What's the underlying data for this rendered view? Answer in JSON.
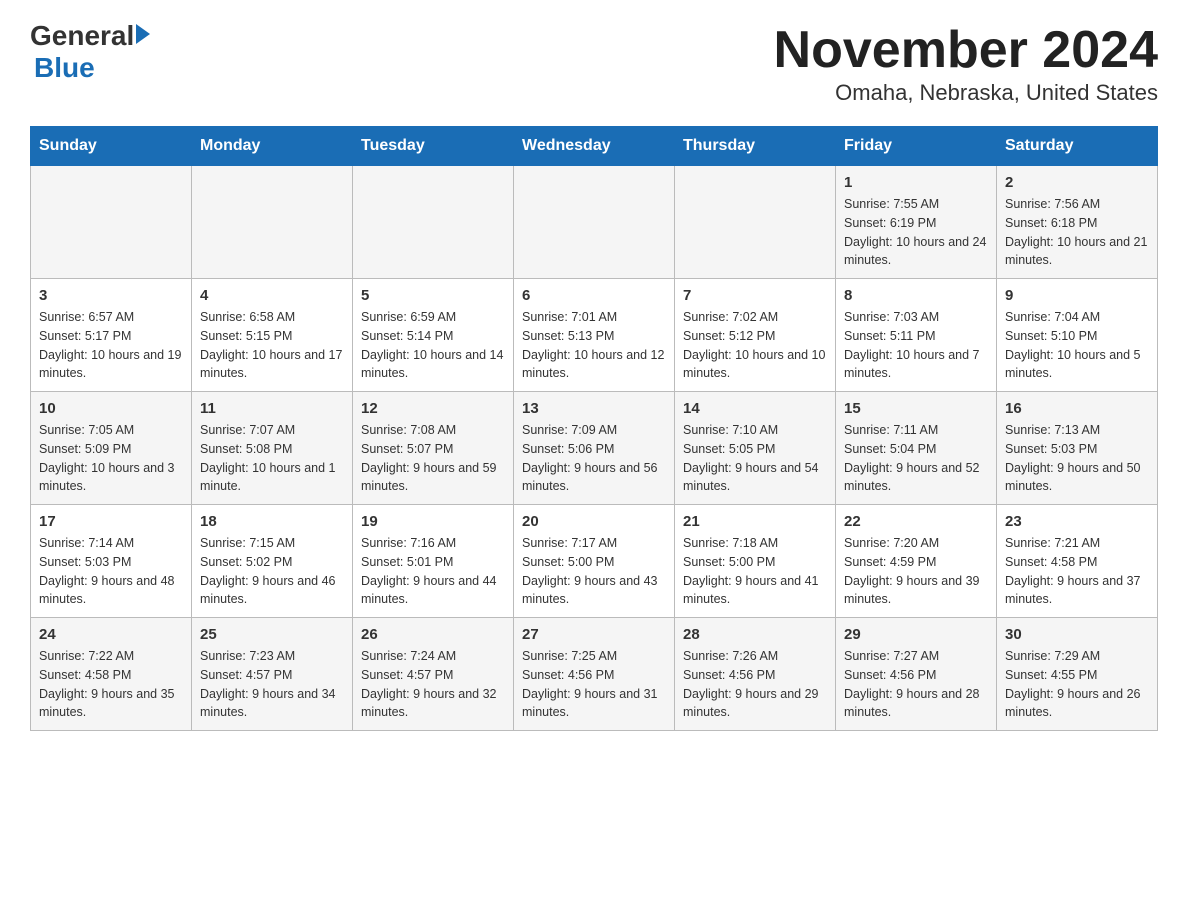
{
  "logo": {
    "general": "General",
    "blue": "Blue"
  },
  "title": "November 2024",
  "subtitle": "Omaha, Nebraska, United States",
  "weekdays": [
    "Sunday",
    "Monday",
    "Tuesday",
    "Wednesday",
    "Thursday",
    "Friday",
    "Saturday"
  ],
  "weeks": [
    [
      {
        "day": "",
        "info": ""
      },
      {
        "day": "",
        "info": ""
      },
      {
        "day": "",
        "info": ""
      },
      {
        "day": "",
        "info": ""
      },
      {
        "day": "",
        "info": ""
      },
      {
        "day": "1",
        "info": "Sunrise: 7:55 AM\nSunset: 6:19 PM\nDaylight: 10 hours and 24 minutes."
      },
      {
        "day": "2",
        "info": "Sunrise: 7:56 AM\nSunset: 6:18 PM\nDaylight: 10 hours and 21 minutes."
      }
    ],
    [
      {
        "day": "3",
        "info": "Sunrise: 6:57 AM\nSunset: 5:17 PM\nDaylight: 10 hours and 19 minutes."
      },
      {
        "day": "4",
        "info": "Sunrise: 6:58 AM\nSunset: 5:15 PM\nDaylight: 10 hours and 17 minutes."
      },
      {
        "day": "5",
        "info": "Sunrise: 6:59 AM\nSunset: 5:14 PM\nDaylight: 10 hours and 14 minutes."
      },
      {
        "day": "6",
        "info": "Sunrise: 7:01 AM\nSunset: 5:13 PM\nDaylight: 10 hours and 12 minutes."
      },
      {
        "day": "7",
        "info": "Sunrise: 7:02 AM\nSunset: 5:12 PM\nDaylight: 10 hours and 10 minutes."
      },
      {
        "day": "8",
        "info": "Sunrise: 7:03 AM\nSunset: 5:11 PM\nDaylight: 10 hours and 7 minutes."
      },
      {
        "day": "9",
        "info": "Sunrise: 7:04 AM\nSunset: 5:10 PM\nDaylight: 10 hours and 5 minutes."
      }
    ],
    [
      {
        "day": "10",
        "info": "Sunrise: 7:05 AM\nSunset: 5:09 PM\nDaylight: 10 hours and 3 minutes."
      },
      {
        "day": "11",
        "info": "Sunrise: 7:07 AM\nSunset: 5:08 PM\nDaylight: 10 hours and 1 minute."
      },
      {
        "day": "12",
        "info": "Sunrise: 7:08 AM\nSunset: 5:07 PM\nDaylight: 9 hours and 59 minutes."
      },
      {
        "day": "13",
        "info": "Sunrise: 7:09 AM\nSunset: 5:06 PM\nDaylight: 9 hours and 56 minutes."
      },
      {
        "day": "14",
        "info": "Sunrise: 7:10 AM\nSunset: 5:05 PM\nDaylight: 9 hours and 54 minutes."
      },
      {
        "day": "15",
        "info": "Sunrise: 7:11 AM\nSunset: 5:04 PM\nDaylight: 9 hours and 52 minutes."
      },
      {
        "day": "16",
        "info": "Sunrise: 7:13 AM\nSunset: 5:03 PM\nDaylight: 9 hours and 50 minutes."
      }
    ],
    [
      {
        "day": "17",
        "info": "Sunrise: 7:14 AM\nSunset: 5:03 PM\nDaylight: 9 hours and 48 minutes."
      },
      {
        "day": "18",
        "info": "Sunrise: 7:15 AM\nSunset: 5:02 PM\nDaylight: 9 hours and 46 minutes."
      },
      {
        "day": "19",
        "info": "Sunrise: 7:16 AM\nSunset: 5:01 PM\nDaylight: 9 hours and 44 minutes."
      },
      {
        "day": "20",
        "info": "Sunrise: 7:17 AM\nSunset: 5:00 PM\nDaylight: 9 hours and 43 minutes."
      },
      {
        "day": "21",
        "info": "Sunrise: 7:18 AM\nSunset: 5:00 PM\nDaylight: 9 hours and 41 minutes."
      },
      {
        "day": "22",
        "info": "Sunrise: 7:20 AM\nSunset: 4:59 PM\nDaylight: 9 hours and 39 minutes."
      },
      {
        "day": "23",
        "info": "Sunrise: 7:21 AM\nSunset: 4:58 PM\nDaylight: 9 hours and 37 minutes."
      }
    ],
    [
      {
        "day": "24",
        "info": "Sunrise: 7:22 AM\nSunset: 4:58 PM\nDaylight: 9 hours and 35 minutes."
      },
      {
        "day": "25",
        "info": "Sunrise: 7:23 AM\nSunset: 4:57 PM\nDaylight: 9 hours and 34 minutes."
      },
      {
        "day": "26",
        "info": "Sunrise: 7:24 AM\nSunset: 4:57 PM\nDaylight: 9 hours and 32 minutes."
      },
      {
        "day": "27",
        "info": "Sunrise: 7:25 AM\nSunset: 4:56 PM\nDaylight: 9 hours and 31 minutes."
      },
      {
        "day": "28",
        "info": "Sunrise: 7:26 AM\nSunset: 4:56 PM\nDaylight: 9 hours and 29 minutes."
      },
      {
        "day": "29",
        "info": "Sunrise: 7:27 AM\nSunset: 4:56 PM\nDaylight: 9 hours and 28 minutes."
      },
      {
        "day": "30",
        "info": "Sunrise: 7:29 AM\nSunset: 4:55 PM\nDaylight: 9 hours and 26 minutes."
      }
    ]
  ],
  "colors": {
    "header_bg": "#1a6db5",
    "header_text": "#ffffff",
    "row_odd": "#f5f5f5",
    "row_even": "#ffffff",
    "text": "#333333",
    "blue": "#1a6db5"
  }
}
